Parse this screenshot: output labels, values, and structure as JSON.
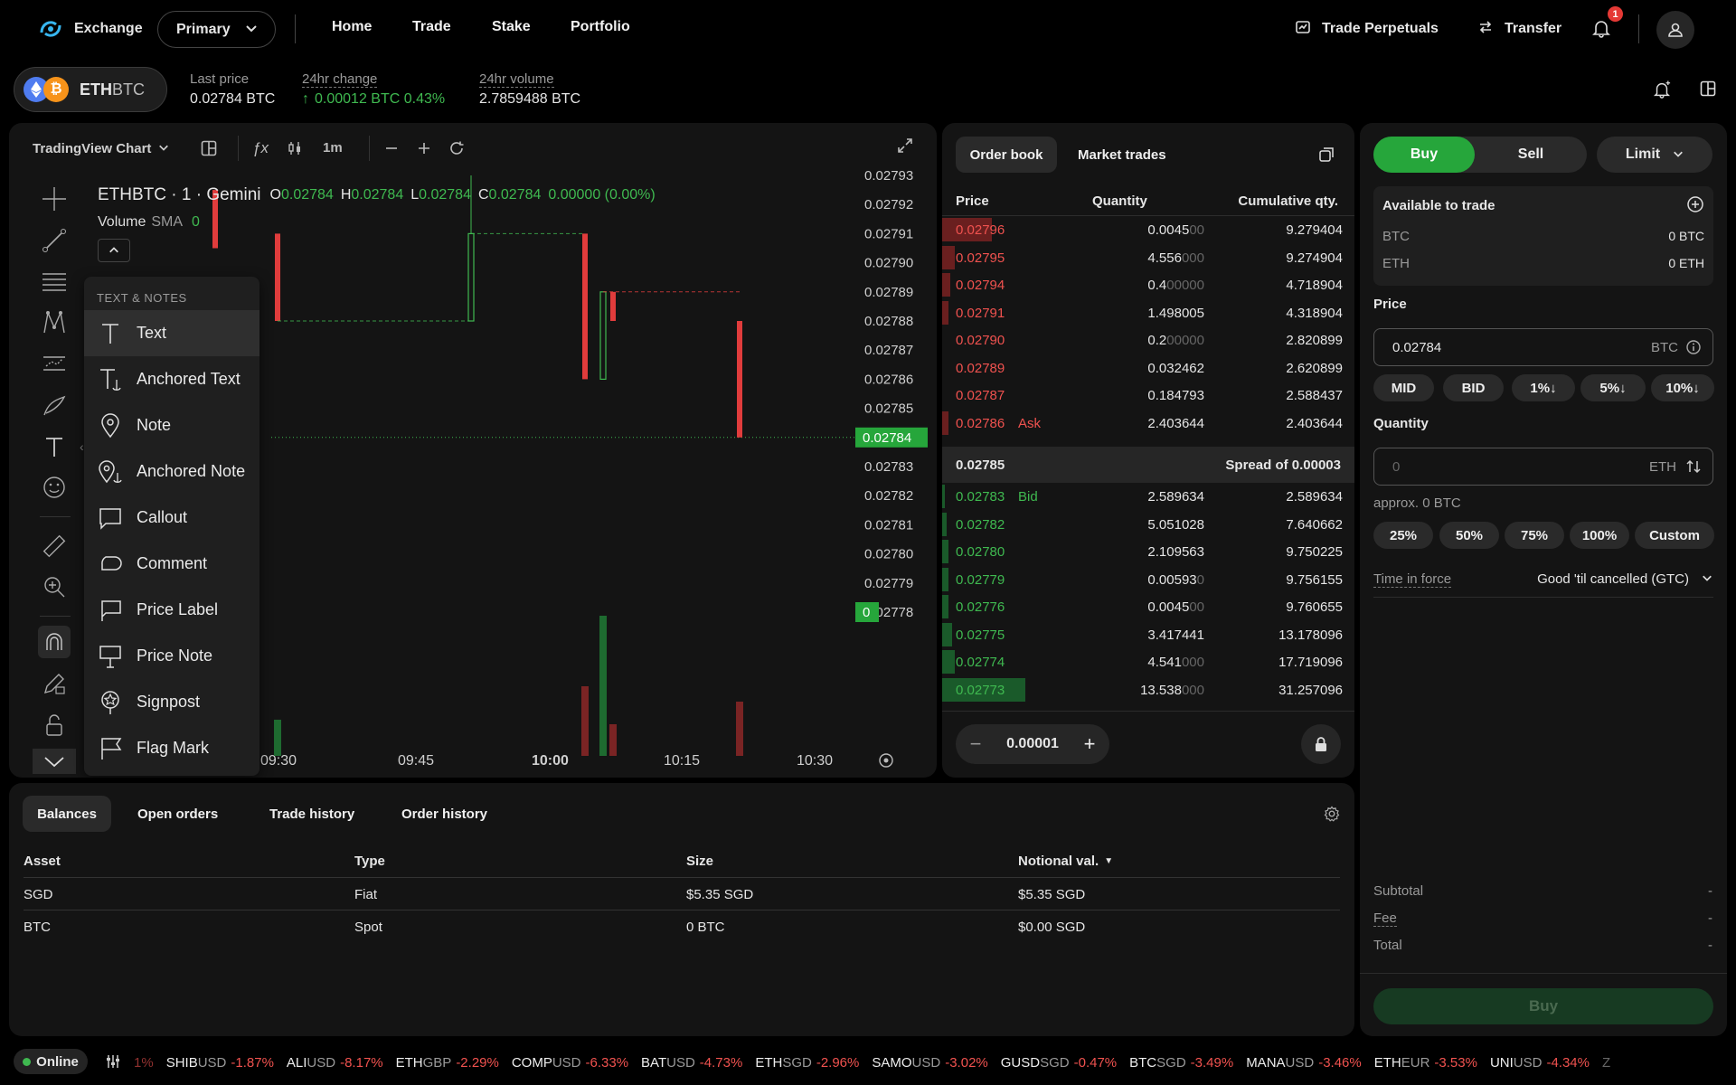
{
  "nav": {
    "brand": "Exchange",
    "account_select": "Primary",
    "links": [
      "Home",
      "Trade",
      "Stake",
      "Portfolio"
    ],
    "trade_perpetuals": "Trade Perpetuals",
    "transfer": "Transfer",
    "notification_count": "1"
  },
  "market": {
    "base": "ETH",
    "quote": "BTC",
    "last_price_label": "Last price",
    "last_price": "0.02784 BTC",
    "change_label": "24hr change",
    "change": "0.00012 BTC 0.43%",
    "volume_label": "24hr volume",
    "volume": "2.7859488 BTC"
  },
  "chart": {
    "source_label": "TradingView Chart",
    "interval": "1m",
    "symbol_line": "ETHBTC · 1 · Gemini",
    "ohlc": {
      "o_label": "O",
      "o": "0.02784",
      "h_label": "H",
      "h": "0.02784",
      "l_label": "L",
      "l": "0.02784",
      "c_label": "C",
      "c": "0.02784",
      "change": "0.00000 (0.00%)"
    },
    "volume_label": "Volume",
    "sma_label": "SMA",
    "sma_value": "0",
    "price_axis": [
      "0.02793",
      "0.02792",
      "0.02791",
      "0.02790",
      "0.02789",
      "0.02788",
      "0.02787",
      "0.02786",
      "0.02785",
      "0.02784",
      "0.02783",
      "0.02782",
      "0.02781",
      "0.02780",
      "0.02779",
      "0.02778"
    ],
    "current_price": "0.02784",
    "volume_marker": "0",
    "time_axis": [
      "09:30",
      "09:45",
      "10:00",
      "10:15",
      "10:30"
    ],
    "time_axis_bold_index": 2,
    "menu_header": "TEXT & NOTES",
    "menu_items": [
      "Text",
      "Anchored Text",
      "Note",
      "Anchored Note",
      "Callout",
      "Comment",
      "Price Label",
      "Price Note",
      "Signpost",
      "Flag Mark"
    ],
    "colors": {
      "up": "#3fb950",
      "down": "#e03c3c"
    },
    "candles": [
      {
        "t": 0,
        "o": 0.027925,
        "c": 0.027905,
        "dir": "down",
        "visible_partial": true
      },
      {
        "t": 1,
        "o": 0.02791,
        "c": 0.02788,
        "dir": "down"
      },
      {
        "t": 2,
        "o": 0.02791,
        "c": 0.02788,
        "dir": "up"
      },
      {
        "t": 3,
        "o": 0.02791,
        "c": 0.02786,
        "dir": "down"
      },
      {
        "t": 4,
        "o": 0.02789,
        "c": 0.02786,
        "dir": "up"
      },
      {
        "t": 5,
        "o": 0.02789,
        "c": 0.02788,
        "dir": "down"
      },
      {
        "t": 6,
        "o": 0.02788,
        "c": 0.02784,
        "dir": "down"
      }
    ]
  },
  "orderbook": {
    "tabs": [
      "Order book",
      "Market trades"
    ],
    "headers": [
      "Price",
      "Quantity",
      "Cumulative qty."
    ],
    "asks": [
      {
        "price": "0.02796",
        "qty": "0.004500",
        "qty_main": "0.0045",
        "qty_dim": "00",
        "cum": "9.279404",
        "depth": 0.12
      },
      {
        "price": "0.02795",
        "qty": "4.556000",
        "qty_main": "4.556",
        "qty_dim": "000",
        "cum": "9.274904",
        "depth": 0.03
      },
      {
        "price": "0.02794",
        "qty": "0.400000",
        "qty_main": "0.4",
        "qty_dim": "00000",
        "cum": "4.718904",
        "depth": 0.02
      },
      {
        "price": "0.02791",
        "qty": "1.498005",
        "qty_main": "1.498005",
        "qty_dim": "",
        "cum": "4.318904",
        "depth": 0.015
      },
      {
        "price": "0.02790",
        "qty": "0.200000",
        "qty_main": "0.2",
        "qty_dim": "00000",
        "cum": "2.820899",
        "depth": 0.0
      },
      {
        "price": "0.02789",
        "qty": "0.032462",
        "qty_main": "0.032462",
        "qty_dim": "",
        "cum": "2.620899",
        "depth": 0.0
      },
      {
        "price": "0.02787",
        "qty": "0.184793",
        "qty_main": "0.184793",
        "qty_dim": "",
        "cum": "2.588437",
        "depth": 0.0
      },
      {
        "price": "0.02786",
        "qty": "2.403644",
        "qty_main": "2.403644",
        "qty_dim": "",
        "cum": "2.403644",
        "depth": 0.015,
        "tag": "Ask"
      }
    ],
    "spread_price": "0.02785",
    "spread_label": "Spread of 0.00003",
    "bids": [
      {
        "price": "0.02783",
        "qty": "2.589634",
        "qty_main": "2.589634",
        "qty_dim": "",
        "cum": "2.589634",
        "depth": 0.005,
        "tag": "Bid"
      },
      {
        "price": "0.02782",
        "qty": "5.051028",
        "qty_main": "5.051028",
        "qty_dim": "",
        "cum": "7.640662",
        "depth": 0.01
      },
      {
        "price": "0.02780",
        "qty": "2.109563",
        "qty_main": "2.109563",
        "qty_dim": "",
        "cum": "9.750225",
        "depth": 0.015
      },
      {
        "price": "0.02779",
        "qty": "0.005930",
        "qty_main": "0.00593",
        "qty_dim": "0",
        "cum": "9.756155",
        "depth": 0.015
      },
      {
        "price": "0.02776",
        "qty": "0.004500",
        "qty_main": "0.0045",
        "qty_dim": "00",
        "cum": "9.760655",
        "depth": 0.015
      },
      {
        "price": "0.02775",
        "qty": "3.417441",
        "qty_main": "3.417441",
        "qty_dim": "",
        "cum": "13.178096",
        "depth": 0.025
      },
      {
        "price": "0.02774",
        "qty": "4.541000",
        "qty_main": "4.541",
        "qty_dim": "000",
        "cum": "17.719096",
        "depth": 0.03
      },
      {
        "price": "0.02773",
        "qty": "13.538000",
        "qty_main": "13.538",
        "qty_dim": "000",
        "cum": "31.257096",
        "depth": 0.2
      }
    ],
    "increment": "0.00001"
  },
  "order_form": {
    "buy": "Buy",
    "sell": "Sell",
    "order_type": "Limit",
    "available_label": "Available to trade",
    "balances": [
      {
        "asset": "BTC",
        "value": "0 BTC"
      },
      {
        "asset": "ETH",
        "value": "0 ETH"
      }
    ],
    "price_label": "Price",
    "price_value": "0.02784",
    "price_unit": "BTC",
    "price_chips": [
      "MID",
      "BID",
      "1%↓",
      "5%↓",
      "10%↓"
    ],
    "quantity_label": "Quantity",
    "quantity_placeholder": "0",
    "quantity_unit": "ETH",
    "approx": "approx. 0 BTC",
    "qty_chips": [
      "25%",
      "50%",
      "75%",
      "100%",
      "Custom"
    ],
    "tif_label": "Time in force",
    "tif_value": "Good 'til cancelled (GTC)",
    "summary": [
      {
        "label": "Subtotal",
        "value": "-"
      },
      {
        "label": "Fee",
        "value": "-"
      },
      {
        "label": "Total",
        "value": "-"
      }
    ],
    "submit": "Buy"
  },
  "bottom": {
    "tabs": [
      "Balances",
      "Open orders",
      "Trade history",
      "Order history"
    ],
    "headers": [
      "Asset",
      "Type",
      "Size",
      "Notional val."
    ],
    "rows": [
      {
        "asset": "SGD",
        "type": "Fiat",
        "size": "$5.35 SGD",
        "notional": "$5.35 SGD"
      },
      {
        "asset": "BTC",
        "type": "Spot",
        "size": "0 BTC",
        "notional": "$0.00 SGD"
      }
    ]
  },
  "footer": {
    "status": "Online",
    "leading_fragment": "1%",
    "ticker": [
      {
        "base": "SHIB",
        "quote": "USD",
        "change": "-1.87%"
      },
      {
        "base": "ALI",
        "quote": "USD",
        "change": "-8.17%"
      },
      {
        "base": "ETH",
        "quote": "GBP",
        "change": "-2.29%"
      },
      {
        "base": "COMP",
        "quote": "USD",
        "change": "-6.33%"
      },
      {
        "base": "BAT",
        "quote": "USD",
        "change": "-4.73%"
      },
      {
        "base": "ETH",
        "quote": "SGD",
        "change": "-2.96%"
      },
      {
        "base": "SAMO",
        "quote": "USD",
        "change": "-3.02%"
      },
      {
        "base": "GUSD",
        "quote": "SGD",
        "change": "-0.47%"
      },
      {
        "base": "BTC",
        "quote": "SGD",
        "change": "-3.49%"
      },
      {
        "base": "MANA",
        "quote": "USD",
        "change": "-3.46%"
      },
      {
        "base": "ETH",
        "quote": "EUR",
        "change": "-3.53%"
      },
      {
        "base": "UNI",
        "quote": "USD",
        "change": "-4.34%"
      }
    ],
    "trailing_fragment": "Z"
  }
}
